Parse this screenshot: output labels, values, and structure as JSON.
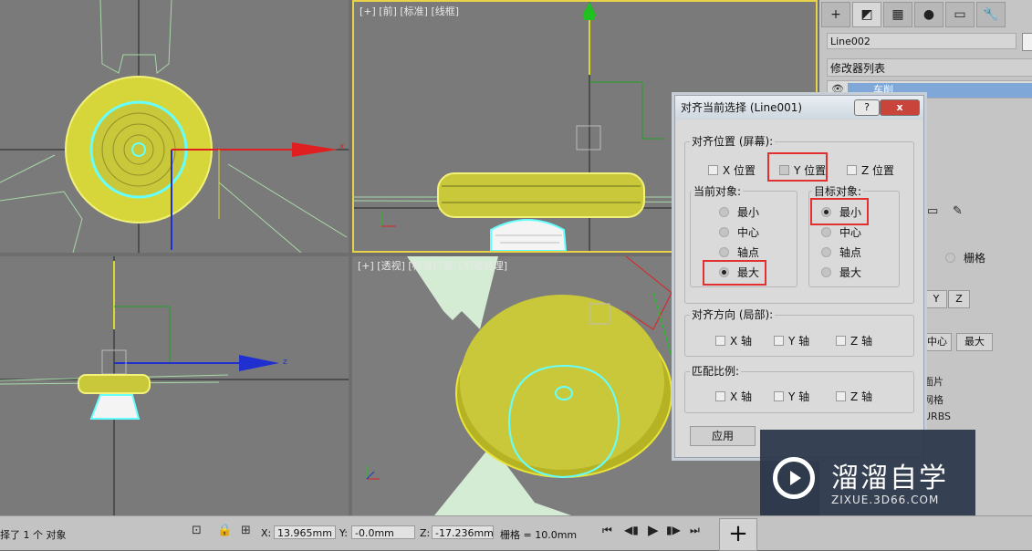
{
  "viewports": {
    "front": {
      "label": "[+] [前] [标准] [线框]"
    },
    "perspective": {
      "label": "[+] [透视] [标准] [默认明暗处理]"
    },
    "axis_labels": {
      "x": "x",
      "z": "z"
    }
  },
  "command_panel": {
    "tab_icons": [
      "create-icon",
      "modify-icon",
      "hierarchy-icon",
      "motion-icon",
      "display-icon",
      "utilities-icon"
    ],
    "tab_glyphs": [
      "+",
      "◩",
      "▦",
      "●",
      "▭",
      "🔧"
    ],
    "object_name": "Line002",
    "modifier_list_label": "修改器列表",
    "stack_item": "车削",
    "fragments": {
      "grid_radio": "栅格",
      "y_button": "Y",
      "z_button": "Z",
      "center_button": "中心",
      "max_button": "最大",
      "patch": "面片",
      "mesh": "网格",
      "nurbs": "URBS"
    }
  },
  "dialog": {
    "title": "对齐当前选择 (Line001)",
    "help_label": "?",
    "close_label": "x",
    "align_position": {
      "label": "对齐位置 (屏幕):",
      "x": "X 位置",
      "y": "Y 位置",
      "z": "Z 位置",
      "y_checked": true
    },
    "current_object": {
      "label": "当前对象:",
      "options": [
        "最小",
        "中心",
        "轴点",
        "最大"
      ],
      "selected": "最大"
    },
    "target_object": {
      "label": "目标对象:",
      "options": [
        "最小",
        "中心",
        "轴点",
        "最大"
      ],
      "selected": "最小"
    },
    "align_orientation": {
      "label": "对齐方向 (局部):",
      "x": "X 轴",
      "y": "Y 轴",
      "z": "Z 轴"
    },
    "match_scale": {
      "label": "匹配比例:",
      "x": "X 轴",
      "y": "Y 轴",
      "z": "Z 轴"
    },
    "apply_label": "应用"
  },
  "status_bar": {
    "selection_text": "择了 1 个 对象",
    "x_label": "X:",
    "x_value": "13.965mm",
    "y_label": "Y:",
    "y_value": "-0.0mm",
    "z_label": "Z:",
    "z_value": "-17.236mm",
    "grid_label": "栅格 = 10.0mm"
  },
  "watermark": {
    "title": "溜溜自学",
    "url": "ZIXUE.3D66.COM"
  },
  "colors": {
    "selected_yellow": "#e8e43a",
    "cyan": "#6ff",
    "axis_red": "#e02020",
    "axis_blue": "#2030d0",
    "axis_green": "#20c020",
    "highlight_red": "#e03030"
  }
}
